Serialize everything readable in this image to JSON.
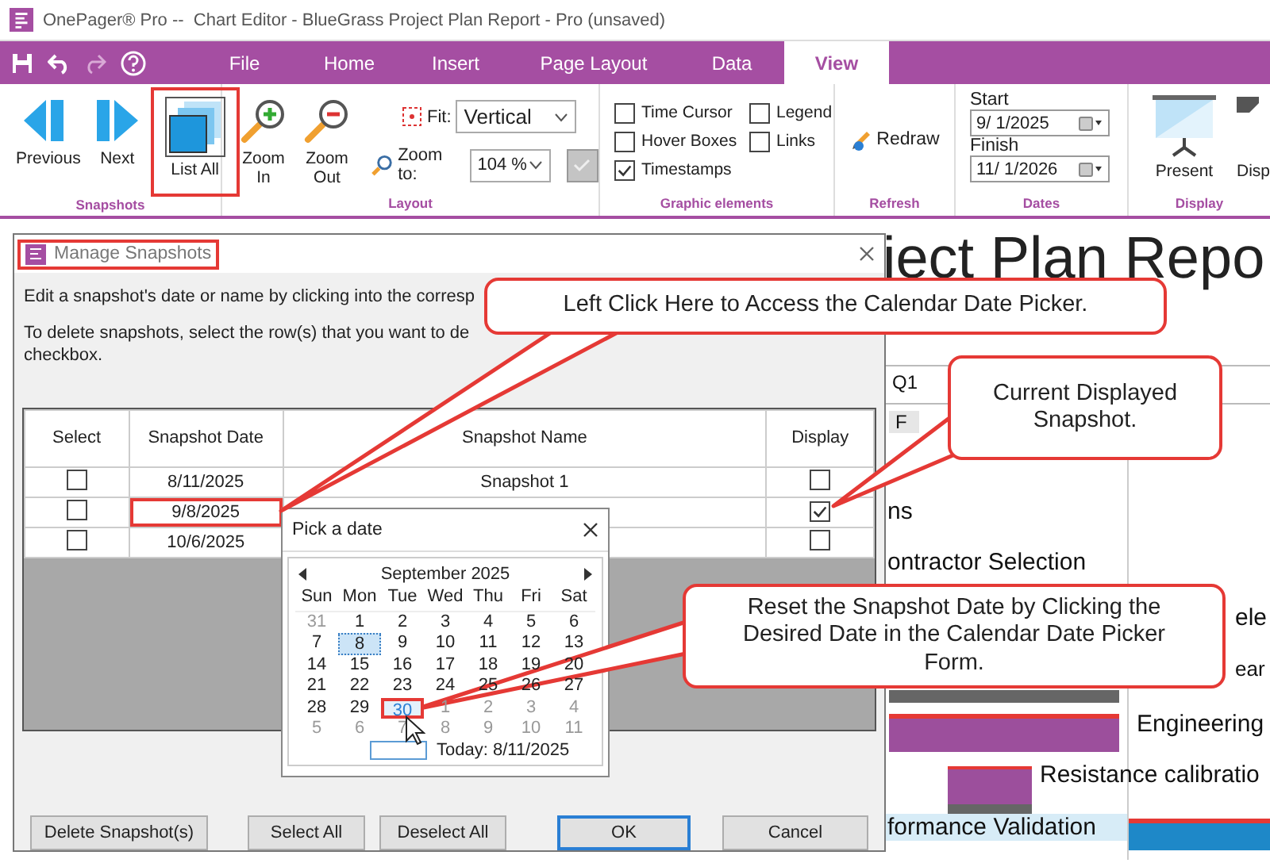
{
  "window": {
    "title": "OnePager® Pro --  Chart Editor - BlueGrass Project Plan Report - Pro (unsaved)"
  },
  "menu": {
    "tabs": [
      {
        "label": "File",
        "selected": false
      },
      {
        "label": "Home",
        "selected": false
      },
      {
        "label": "Insert",
        "selected": false
      },
      {
        "label": "Page Layout",
        "selected": false
      },
      {
        "label": "Data",
        "selected": false
      },
      {
        "label": "View",
        "selected": true
      }
    ]
  },
  "snapshots_group": {
    "label": "Snapshots",
    "buttons": [
      {
        "kind": "previous",
        "label": "Previous",
        "highlighted": false
      },
      {
        "kind": "next",
        "label": "Next",
        "highlighted": false
      },
      {
        "kind": "list",
        "label": "List All",
        "highlighted": true
      }
    ]
  },
  "layout_group": {
    "label": "Layout",
    "zoom_buttons": [
      {
        "kind": "zoom-in",
        "label": "Zoom In"
      },
      {
        "kind": "zoom-out",
        "label": "Zoom Out"
      }
    ],
    "fit_label": "Fit:",
    "fit_value": "Vertical",
    "zoom_label": "Zoom to:",
    "zoom_value": "104 %",
    "apply_disabled": true
  },
  "graphic_group": {
    "label": "Graphic elements",
    "options": [
      {
        "label": "Time Cursor",
        "checked": false
      },
      {
        "label": "Hover Boxes",
        "checked": false
      },
      {
        "label": "Timestamps",
        "checked": true
      },
      {
        "label": "Legend",
        "checked": false
      },
      {
        "label": "Links",
        "checked": false
      }
    ]
  },
  "refresh_group": {
    "label": "Refresh",
    "button": "Redraw"
  },
  "dates_group": {
    "label": "Dates",
    "fields": [
      {
        "label": "Start",
        "value": "9/ 1/2025"
      },
      {
        "label": "Finish",
        "value": "11/ 1/2026"
      }
    ]
  },
  "display_group": {
    "label": "Display",
    "buttons": [
      "Present",
      "Disp"
    ]
  },
  "chart": {
    "title": "iect Plan Repo",
    "quarter": "Q1",
    "month": "F",
    "rows": [
      {
        "label": "ns"
      },
      {
        "label": "ontractor Selection"
      },
      {
        "label": "ele"
      },
      {
        "label": "ear"
      },
      {
        "label": "Engineering"
      },
      {
        "label": "Resistance calibratio"
      },
      {
        "label": "formance Validation"
      }
    ]
  },
  "dialog": {
    "title": "Manage Snapshots",
    "title_highlighted": true,
    "instructions": [
      "Edit a snapshot's date or name by clicking into the corresp",
      "To delete snapshots, select the row(s) that you want to de",
      "checkbox."
    ],
    "columns": [
      "Select",
      "Snapshot Date",
      "Snapshot Name",
      "Display"
    ],
    "rows": [
      {
        "checked": false,
        "date": "8/11/2025",
        "date_highlighted": false,
        "name": "Snapshot 1",
        "display": false
      },
      {
        "checked": false,
        "date": "9/8/2025",
        "date_highlighted": true,
        "display": true
      },
      {
        "checked": false,
        "date": "10/6/2025",
        "date_highlighted": false,
        "display": false
      }
    ],
    "buttons": [
      {
        "label": "Delete Snapshot(s)",
        "default": false
      },
      {
        "label": "Select All",
        "default": false
      },
      {
        "label": "Deselect All",
        "default": false
      },
      {
        "label": "OK",
        "default": true
      },
      {
        "label": "Cancel",
        "default": false
      }
    ]
  },
  "picker": {
    "title": "Pick a date",
    "month": "September 2025",
    "weekdays": [
      "Sun",
      "Mon",
      "Tue",
      "Wed",
      "Thu",
      "Fri",
      "Sat"
    ],
    "days": [
      {
        "label": "31",
        "muted": true,
        "selected": false,
        "highlighted": false
      },
      {
        "label": "1",
        "muted": false,
        "selected": false,
        "highlighted": false
      },
      {
        "label": "2",
        "muted": false,
        "selected": false,
        "highlighted": false
      },
      {
        "label": "3",
        "muted": false,
        "selected": false,
        "highlighted": false
      },
      {
        "label": "4",
        "muted": false,
        "selected": false,
        "highlighted": false
      },
      {
        "label": "5",
        "muted": false,
        "selected": false,
        "highlighted": false
      },
      {
        "label": "6",
        "muted": false,
        "selected": false,
        "highlighted": false
      },
      {
        "label": "7",
        "muted": false,
        "selected": false,
        "highlighted": false
      },
      {
        "label": "8",
        "muted": false,
        "selected": true,
        "highlighted": false
      },
      {
        "label": "9",
        "muted": false,
        "selected": false,
        "highlighted": false
      },
      {
        "label": "10",
        "muted": false,
        "selected": false,
        "highlighted": false
      },
      {
        "label": "11",
        "muted": false,
        "selected": false,
        "highlighted": false
      },
      {
        "label": "12",
        "muted": false,
        "selected": false,
        "highlighted": false
      },
      {
        "label": "13",
        "muted": false,
        "selected": false,
        "highlighted": false
      },
      {
        "label": "14",
        "muted": false,
        "selected": false,
        "highlighted": false
      },
      {
        "label": "15",
        "muted": false,
        "selected": false,
        "highlighted": false
      },
      {
        "label": "16",
        "muted": false,
        "selected": false,
        "highlighted": false
      },
      {
        "label": "17",
        "muted": false,
        "selected": false,
        "highlighted": false
      },
      {
        "label": "18",
        "muted": false,
        "selected": false,
        "highlighted": false
      },
      {
        "label": "19",
        "muted": false,
        "selected": false,
        "highlighted": false
      },
      {
        "label": "20",
        "muted": false,
        "selected": false,
        "highlighted": false
      },
      {
        "label": "21",
        "muted": false,
        "selected": false,
        "highlighted": false
      },
      {
        "label": "22",
        "muted": false,
        "selected": false,
        "highlighted": false
      },
      {
        "label": "23",
        "muted": false,
        "selected": false,
        "highlighted": false
      },
      {
        "label": "24",
        "muted": false,
        "selected": false,
        "highlighted": false
      },
      {
        "label": "25",
        "muted": false,
        "selected": false,
        "highlighted": false
      },
      {
        "label": "26",
        "muted": false,
        "selected": false,
        "highlighted": false
      },
      {
        "label": "27",
        "muted": false,
        "selected": false,
        "highlighted": false
      },
      {
        "label": "28",
        "muted": false,
        "selected": false,
        "highlighted": false
      },
      {
        "label": "29",
        "muted": false,
        "selected": false,
        "highlighted": false
      },
      {
        "label": "30",
        "muted": false,
        "selected": false,
        "highlighted": true
      },
      {
        "label": "1",
        "muted": true,
        "selected": false,
        "highlighted": false
      },
      {
        "label": "2",
        "muted": true,
        "selected": false,
        "highlighted": false
      },
      {
        "label": "3",
        "muted": true,
        "selected": false,
        "highlighted": false
      },
      {
        "label": "4",
        "muted": true,
        "selected": false,
        "highlighted": false
      },
      {
        "label": "5",
        "muted": true,
        "selected": false,
        "highlighted": false
      },
      {
        "label": "6",
        "muted": true,
        "selected": false,
        "highlighted": false
      },
      {
        "label": "7",
        "muted": true,
        "selected": false,
        "highlighted": false
      },
      {
        "label": "8",
        "muted": true,
        "selected": false,
        "highlighted": false
      },
      {
        "label": "9",
        "muted": true,
        "selected": false,
        "highlighted": false
      },
      {
        "label": "10",
        "muted": true,
        "selected": false,
        "highlighted": false
      },
      {
        "label": "11",
        "muted": true,
        "selected": false,
        "highlighted": false
      }
    ],
    "today": "Today: 8/11/2025"
  },
  "callouts": [
    {
      "text": "Left Click Here to Access the Calendar Date Picker."
    },
    {
      "text": "Current Displayed Snapshot."
    },
    {
      "text": "Reset the Snapshot Date by Clicking the Desired Date in the Calendar Date Picker Form."
    }
  ]
}
